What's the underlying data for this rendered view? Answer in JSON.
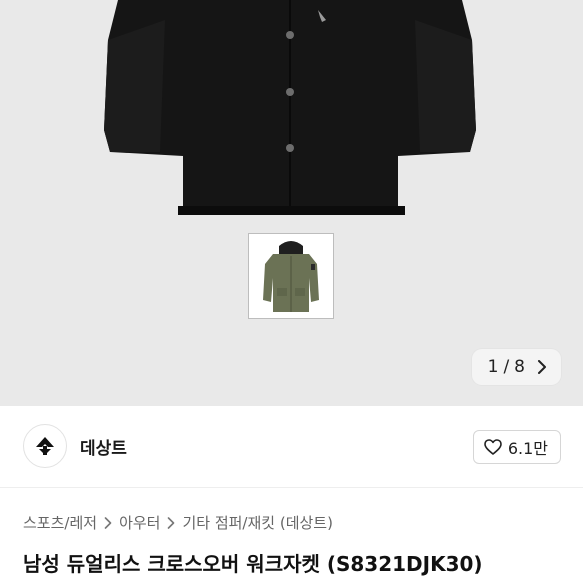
{
  "gallery": {
    "current": "1",
    "separator": "/",
    "total": "8",
    "next_icon": "chevron-right-icon",
    "background": "#e9e9e9"
  },
  "seller": {
    "name": "데상트",
    "logo_icon": "descente-logo-icon"
  },
  "like": {
    "icon": "heart-outline-icon",
    "count": "6.1만"
  },
  "breadcrumb": {
    "items": [
      "스포츠/레저",
      "아우터",
      "기타 점퍼/재킷 (데상트)"
    ],
    "separator_icon": "chevron-right-icon"
  },
  "product": {
    "title": "남성 듀얼리스 크로스오버 워크자켓 (S8321DJK30)"
  }
}
